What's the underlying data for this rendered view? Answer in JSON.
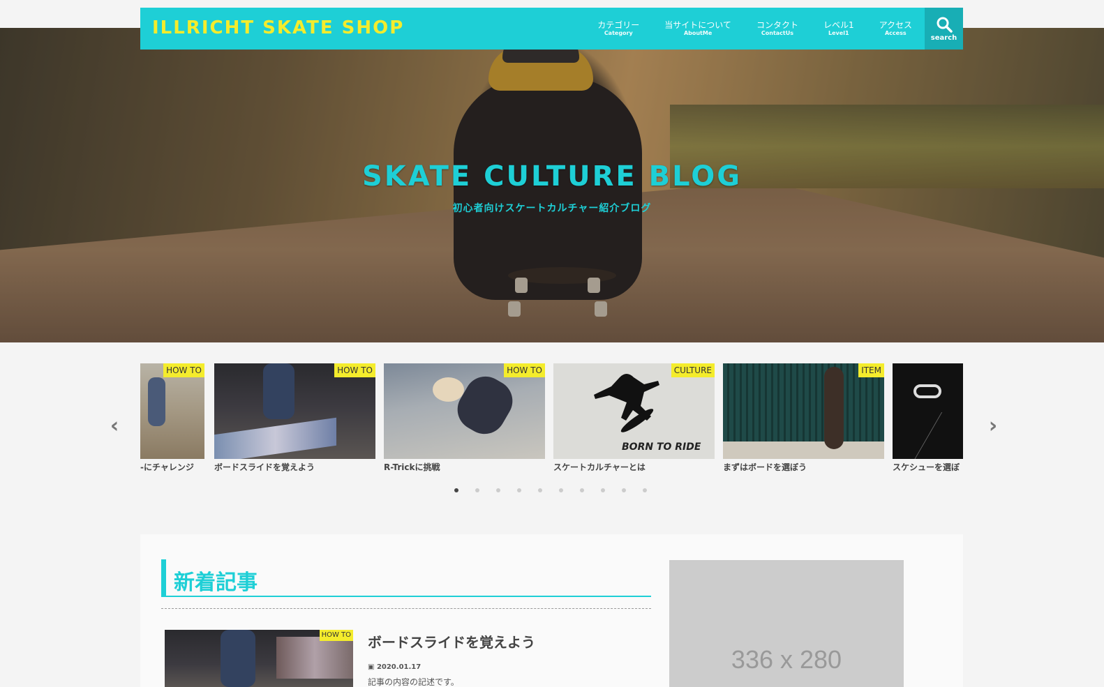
{
  "header": {
    "logo": "ILLRICHT SKATE SHOP",
    "nav": [
      {
        "jp": "カテゴリー",
        "en": "Category"
      },
      {
        "jp": "当サイトについて",
        "en": "AboutMe"
      },
      {
        "jp": "コンタクト",
        "en": "ContactUs"
      },
      {
        "jp": "レベル1",
        "en": "Level1"
      },
      {
        "jp": "アクセス",
        "en": "Access"
      }
    ],
    "search_label": "search",
    "search_icon": "search-icon"
  },
  "hero": {
    "title": "SKATE CULTURE BLOG",
    "subtitle": "初心者向けスケートカルチャー紹介ブログ"
  },
  "carousel": {
    "slides": [
      {
        "category": "HOW TO",
        "title": "-にチャレンジ"
      },
      {
        "category": "HOW TO",
        "title": "ボードスライドを覚えよう"
      },
      {
        "category": "HOW TO",
        "title": "R-Trickに挑戦"
      },
      {
        "category": "CULTURE",
        "title": "スケートカルチャーとは"
      },
      {
        "category": "ITEM",
        "title": "まずはボードを選ぼう"
      },
      {
        "category": "",
        "title": "スケシューを選ぼ"
      }
    ],
    "stencil_text": "BORN TO RIDE",
    "dots_count": 10,
    "active_dot": 0
  },
  "main": {
    "section_title": "新着記事",
    "post": {
      "category": "HOW TO",
      "title": "ボードスライドを覚えよう",
      "date": "2020.01.17",
      "excerpt": "記事の内容の記述です。"
    },
    "ad_label": "336 x 280"
  },
  "colors": {
    "accent": "#1ecfd6",
    "logo_yellow": "#f4ec2c",
    "category_badge": "#f4ec2c"
  }
}
